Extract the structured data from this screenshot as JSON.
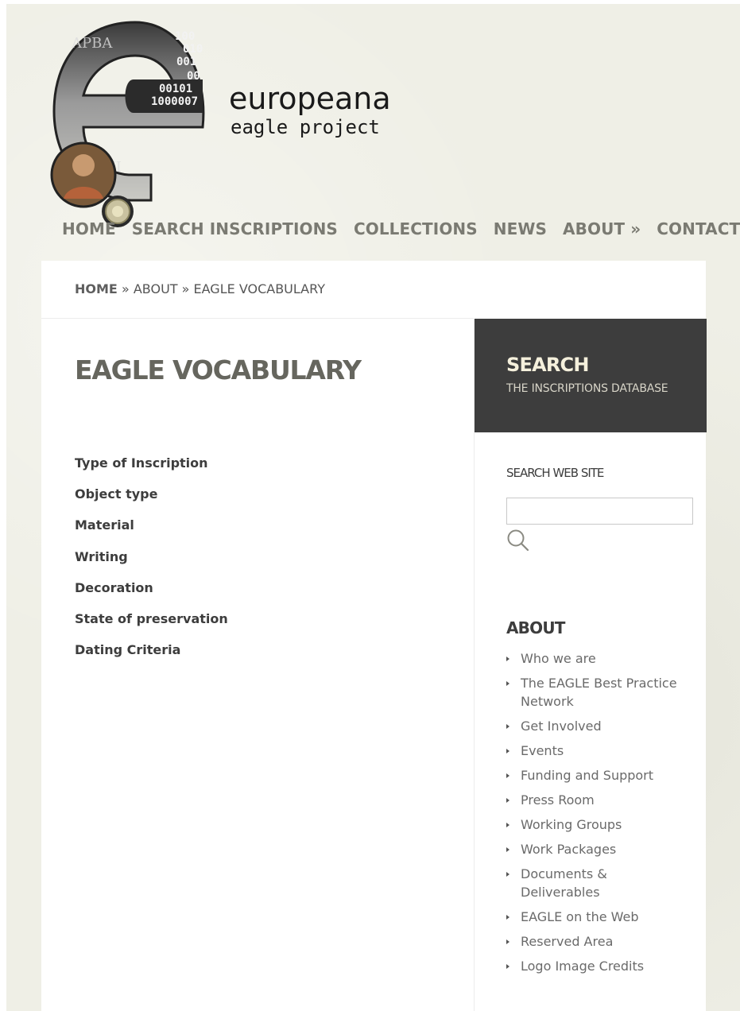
{
  "header": {
    "brand_name": "europeana",
    "brand_sub": "eagle project"
  },
  "nav": {
    "items": [
      {
        "label": "HOME"
      },
      {
        "label": "SEARCH INSCRIPTIONS"
      },
      {
        "label": "COLLECTIONS"
      },
      {
        "label": "NEWS"
      },
      {
        "label": "ABOUT »"
      },
      {
        "label": "CONTACTS"
      }
    ]
  },
  "breadcrumb": {
    "home": "HOME",
    "sep": "»",
    "about": "ABOUT",
    "current": "EAGLE VOCABULARY"
  },
  "main": {
    "title": "EAGLE VOCABULARY",
    "items": [
      {
        "label": "Type of Inscription"
      },
      {
        "label": "Object type"
      },
      {
        "label": "Material"
      },
      {
        "label": "Writing"
      },
      {
        "label": "Decoration"
      },
      {
        "label": "State of preservation"
      },
      {
        "label": "Dating Criteria"
      }
    ]
  },
  "sidebar": {
    "search_title": "SEARCH",
    "search_subtitle": "THE INSCRIPTIONS DATABASE",
    "search_site_label": "SEARCH WEB SITE",
    "search_value": "",
    "about_title": "ABOUT",
    "about_items": [
      {
        "label": "Who we are"
      },
      {
        "label": "The EAGLE Best Practice Network"
      },
      {
        "label": "Get Involved"
      },
      {
        "label": "Events"
      },
      {
        "label": "Funding and Support"
      },
      {
        "label": "Press Room"
      },
      {
        "label": "Working Groups"
      },
      {
        "label": "Work Packages"
      },
      {
        "label": "Documents & Deliverables"
      },
      {
        "label": "EAGLE on the Web"
      },
      {
        "label": "Reserved Area"
      },
      {
        "label": "Logo Image Credits"
      }
    ]
  },
  "colors": {
    "page_bg": "#efefe6",
    "search_panel_bg": "#3d3d3d",
    "nav_text": "#7a7a72"
  }
}
